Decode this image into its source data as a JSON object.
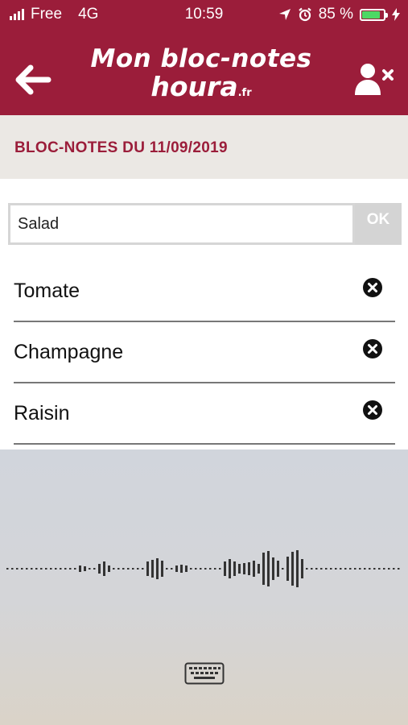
{
  "status_bar": {
    "carrier": "Free",
    "network": "4G",
    "time": "10:59",
    "battery": "85 %",
    "battery_level": 0.85,
    "battery_color": "#4cd964",
    "icons": [
      "signal-icon",
      "location-arrow-icon",
      "alarm-icon",
      "battery-icon",
      "charging-bolt-icon"
    ]
  },
  "header": {
    "logo_line1": "Mon bloc-notes",
    "logo_line2": "houra",
    "logo_tld": ".fr",
    "back_icon": "arrow-left-icon",
    "action_icon": "user-remove-icon",
    "background": "#9b1d3a"
  },
  "notes": {
    "title": "BLOC-NOTES DU 11/09/2019",
    "input_value": "Salad",
    "ok_label": "OK",
    "items": [
      {
        "label": "Tomate"
      },
      {
        "label": "Champagne"
      },
      {
        "label": "Raisin"
      }
    ]
  },
  "dictation": {
    "icons": [
      "waveform-icon",
      "keyboard-icon"
    ]
  }
}
